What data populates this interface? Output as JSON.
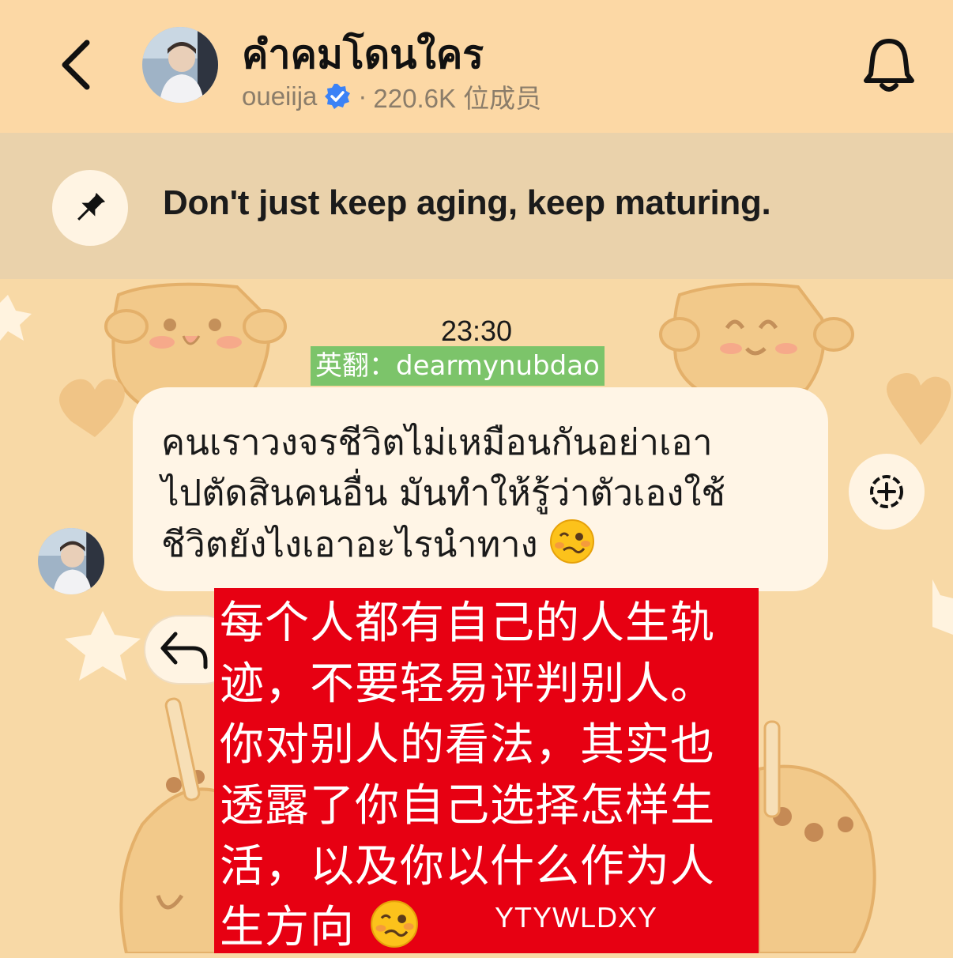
{
  "header": {
    "title": "คำคมโดนใคร",
    "username": "oueiija",
    "separator": "·",
    "members": "220.6K 位成员",
    "back_icon": "chevron-left-icon",
    "bell_icon": "bell-icon"
  },
  "pinned": {
    "text": "Don't just keep aging, keep maturing.",
    "icon": "pin-icon"
  },
  "chat": {
    "time": "23:30",
    "translator": "英翻：dearmynubdao",
    "message_lines": "คนเราวงจรชีวิตไม่เหมือนกันอย่าเอา\nไปตัดสินคนอื่น มันทำให้รู้ว่าตัวเองใช้\nชีวิตยังไงเอาอะไรนำทาง",
    "message_emoji": "woozy-face-emoji",
    "translation_lines": "每个人都有自己的人生轨\n迹，不要轻易评判别人。\n你对别人的看法，其实也\n透露了你自己选择怎样生\n活，以及你以什么作为人\n生方向",
    "translation_emoji": "woozy-face-emoji",
    "watermark": "YTYWLDXY"
  },
  "colors": {
    "header_bg": "#fcd8a5",
    "pinned_bg": "#ead2ab",
    "chat_bg": "#f8d9a6",
    "bubble_bg": "#fff5e6",
    "tag_bg": "#7cc46a",
    "overlay_bg": "#e70012",
    "verified": "#3b82f6"
  }
}
